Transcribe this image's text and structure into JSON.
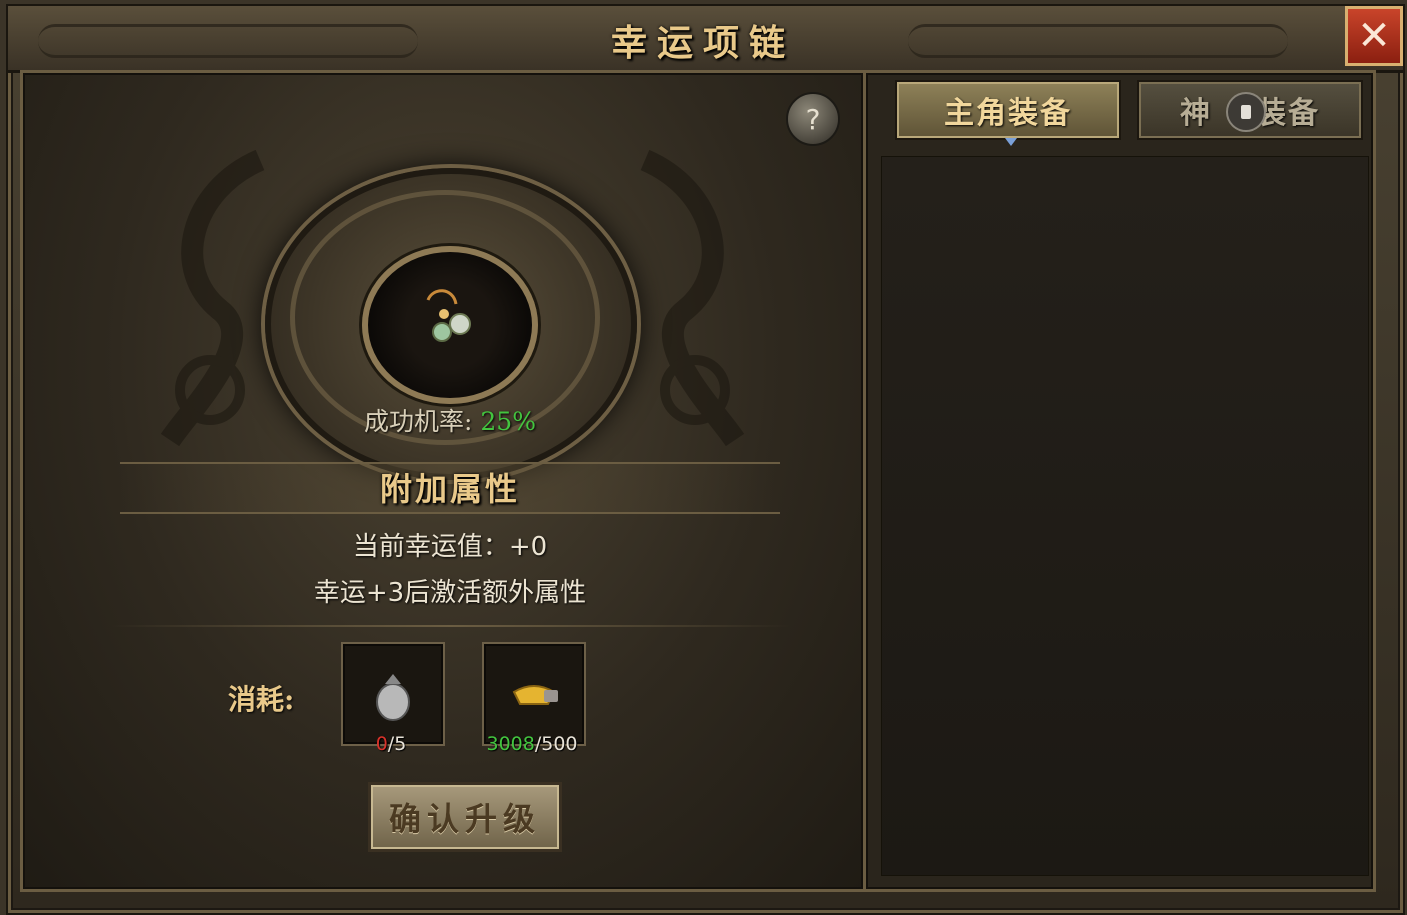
{
  "window": {
    "title": "幸运项链",
    "close_icon": "close-icon"
  },
  "help": {
    "label": "?"
  },
  "upgrade": {
    "success_label": "成功机率:",
    "success_value": "25%",
    "section_title": "附加属性",
    "current_luck": "当前幸运值：+0",
    "activation_hint": "幸运+3后激活额外属性",
    "cost_label": "消耗:",
    "materials": [
      {
        "icon": "silver-pouch-icon",
        "have": "0",
        "need": "/5"
      },
      {
        "icon": "gold-ingot-icon",
        "have": "3008",
        "need": "/500"
      }
    ],
    "confirm_label": "确认升级"
  },
  "tabs": [
    {
      "label": "主角装备",
      "active": true
    },
    {
      "label": "神",
      "label_suffix": "装备",
      "active": false,
      "locked": true
    }
  ],
  "colors": {
    "accent_gold": "#e9c98a",
    "success_green": "#43c53f",
    "insufficient_red": "#d8322a",
    "close_red": "#b5341f"
  }
}
